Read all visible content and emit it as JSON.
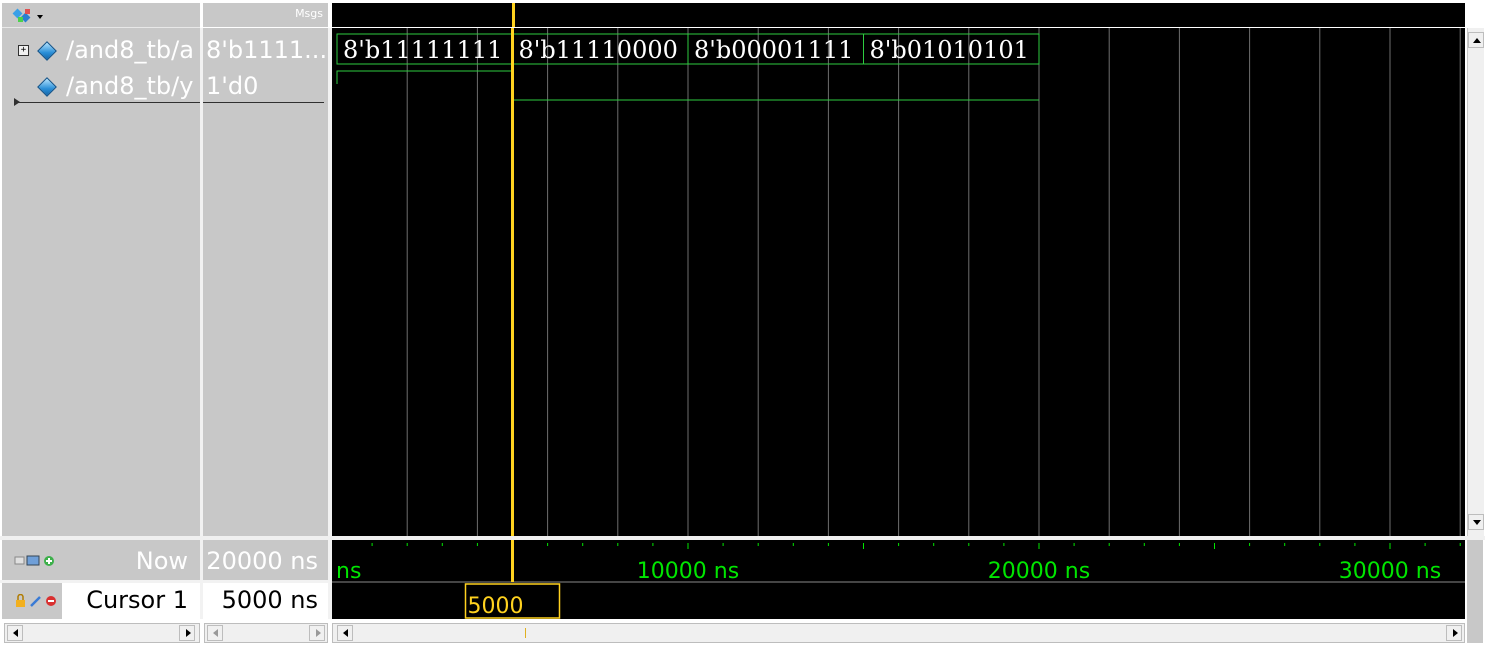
{
  "header": {
    "msgs_label": "Msgs"
  },
  "signals": [
    {
      "name": "/and8_tb/a",
      "value": "8'b1111...",
      "expandable": true
    },
    {
      "name": "/and8_tb/y",
      "value": "1'd0",
      "expandable": false
    }
  ],
  "waveform": {
    "bus_values": [
      "8'b11111111",
      "8'b11110000",
      "8'b00001111",
      "8'b01010101"
    ],
    "time_units": "ns",
    "y_value_before_cursor": 1,
    "y_value_after_cursor": 0
  },
  "ruler": {
    "labels": [
      "ns",
      "10000 ns",
      "20000 ns",
      "30000 ns"
    ]
  },
  "status": {
    "now_label": "Now",
    "now_value": "20000 ns",
    "cursor_label": "Cursor 1",
    "cursor_value": "5000 ns",
    "cursor_marker": "5000"
  },
  "colors": {
    "wave_green": "#2ecc40",
    "cursor_yellow": "#ffd21f",
    "grid": "#6e6e6e",
    "ruler_text": "#00e600"
  },
  "icons": [
    "wave-window-icon",
    "expand-plus-icon",
    "signal-diamond-icon",
    "now-toolbar-icons",
    "cursor-lock-icon",
    "cursor-edit-icon",
    "cursor-remove-icon"
  ]
}
